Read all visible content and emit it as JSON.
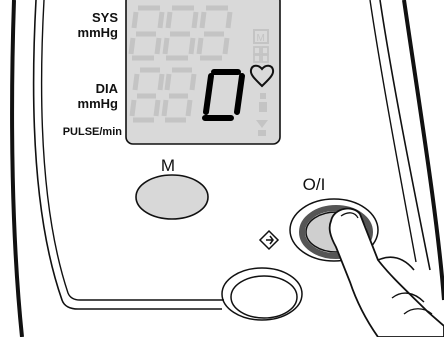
{
  "labels": {
    "sys": "SYS",
    "sys_unit": "mmHg",
    "dia": "DIA",
    "dia_unit": "mmHg",
    "pulse": "PULSE/min"
  },
  "display": {
    "dia_digit": "0",
    "mem_indicator": "M",
    "heart_symbol": "♡"
  },
  "buttons": {
    "memory_label": "M",
    "power_label": "O/I"
  },
  "colors": {
    "lcd_background": "#d9d9d9",
    "segment_ghost": "#c4c4c4",
    "segment_active": "#000000",
    "button_fill": "#d8d8d8",
    "outline": "#111111"
  },
  "icons": {
    "heart": "heart-icon",
    "start": "start-diamond-icon",
    "power": "power-button",
    "finger": "pointing-finger"
  }
}
